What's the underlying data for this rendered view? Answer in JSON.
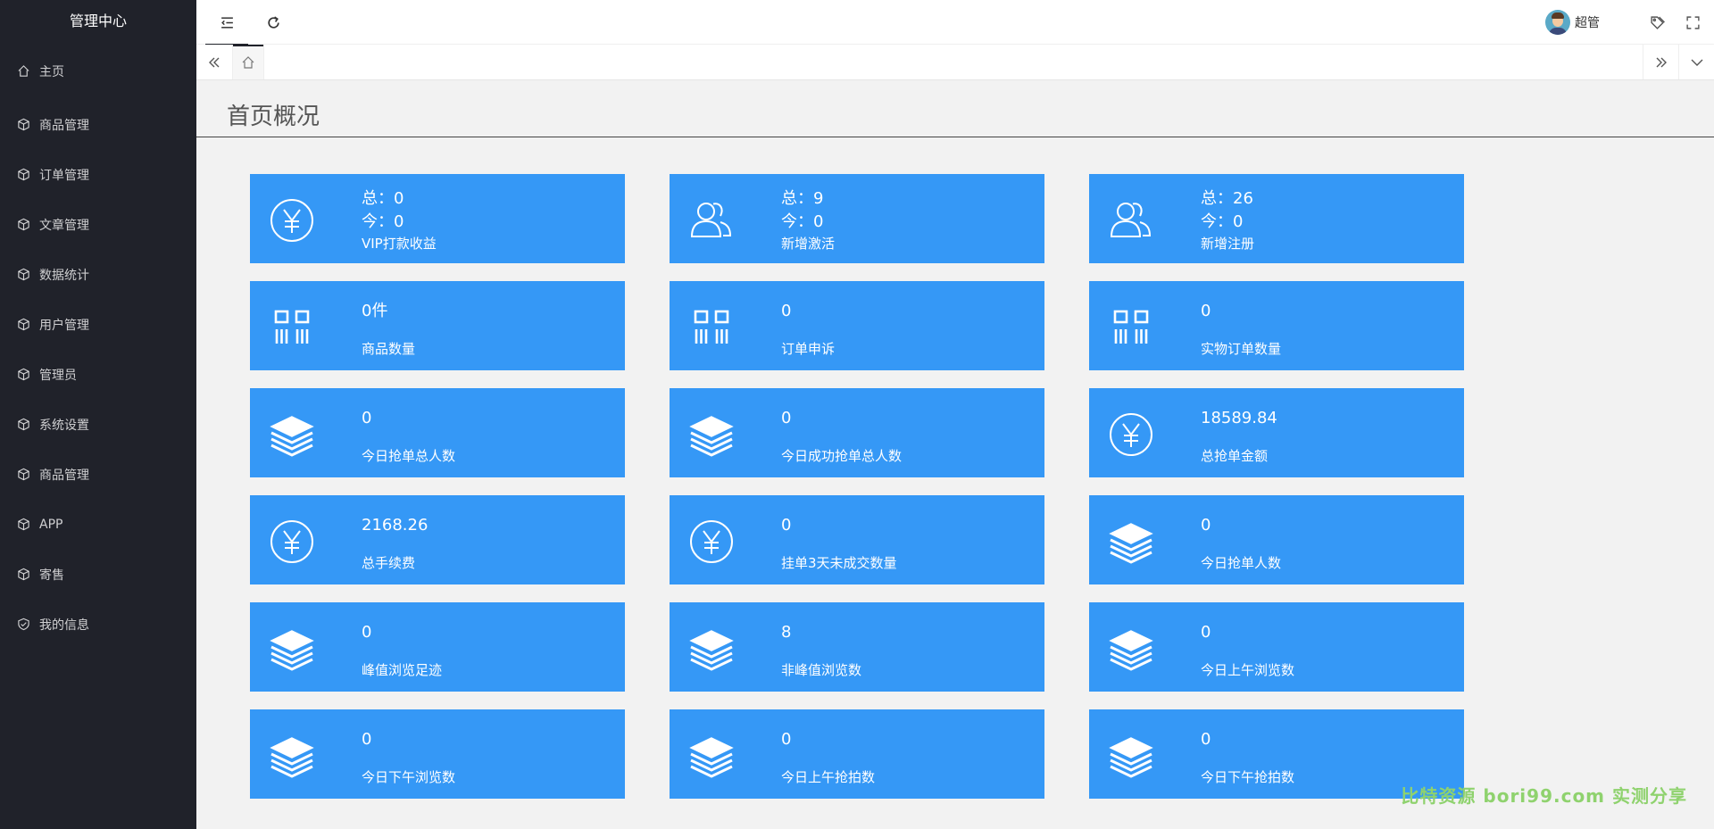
{
  "sidebar": {
    "title": "管理中心",
    "items": [
      {
        "label": "主页",
        "icon": "home-icon"
      },
      {
        "label": "商品管理",
        "icon": "cube-icon"
      },
      {
        "label": "订单管理",
        "icon": "cube-icon"
      },
      {
        "label": "文章管理",
        "icon": "cube-icon"
      },
      {
        "label": "数据统计",
        "icon": "cube-icon"
      },
      {
        "label": "用户管理",
        "icon": "cube-icon"
      },
      {
        "label": "管理员",
        "icon": "cube-icon"
      },
      {
        "label": "系统设置",
        "icon": "cube-icon"
      },
      {
        "label": "商品管理",
        "icon": "cube-icon"
      },
      {
        "label": "APP",
        "icon": "cube-icon"
      },
      {
        "label": "寄售",
        "icon": "cube-icon"
      },
      {
        "label": "我的信息",
        "icon": "shield-check-icon"
      }
    ]
  },
  "header": {
    "user_name": "超管"
  },
  "page": {
    "title": "首页概况"
  },
  "cards": [
    {
      "icon": "yen",
      "layout": "two-line",
      "total": "总：0",
      "today": "今：0",
      "label": "VIP打款收益"
    },
    {
      "icon": "users",
      "layout": "two-line",
      "total": "总：9",
      "today": "今：0",
      "label": "新增激活"
    },
    {
      "icon": "users",
      "layout": "two-line",
      "total": "总：26",
      "today": "今：0",
      "label": "新增注册"
    },
    {
      "icon": "barcode",
      "layout": "single",
      "value": "0件",
      "label": "商品数量"
    },
    {
      "icon": "barcode",
      "layout": "single",
      "value": "0",
      "label": "订单申诉"
    },
    {
      "icon": "barcode",
      "layout": "single",
      "value": "0",
      "label": "实物订单数量"
    },
    {
      "icon": "layers",
      "layout": "single",
      "value": "0",
      "label": "今日抢单总人数"
    },
    {
      "icon": "layers",
      "layout": "single",
      "value": "0",
      "label": "今日成功抢单总人数"
    },
    {
      "icon": "yen",
      "layout": "single",
      "value": "18589.84",
      "label": "总抢单金额"
    },
    {
      "icon": "yen",
      "layout": "single",
      "value": "2168.26",
      "label": "总手续费"
    },
    {
      "icon": "yen",
      "layout": "single",
      "value": "0",
      "label": "挂单3天未成交数量"
    },
    {
      "icon": "layers",
      "layout": "single",
      "value": "0",
      "label": "今日抢单人数"
    },
    {
      "icon": "layers",
      "layout": "single",
      "value": "0",
      "label": "峰值浏览足迹"
    },
    {
      "icon": "layers",
      "layout": "single",
      "value": "8",
      "label": "非峰值浏览数"
    },
    {
      "icon": "layers",
      "layout": "single",
      "value": "0",
      "label": "今日上午浏览数"
    },
    {
      "icon": "layers",
      "layout": "single",
      "value": "0",
      "label": "今日下午浏览数"
    },
    {
      "icon": "layers",
      "layout": "single",
      "value": "0",
      "label": "今日上午抢拍数"
    },
    {
      "icon": "layers",
      "layout": "single",
      "value": "0",
      "label": "今日下午抢拍数"
    }
  ],
  "watermark": "比特资源 bori99.com 实测分享",
  "colors": {
    "sidebar_bg": "#20222a",
    "card_bg": "#3598f6",
    "page_bg": "#f2f2f2"
  }
}
